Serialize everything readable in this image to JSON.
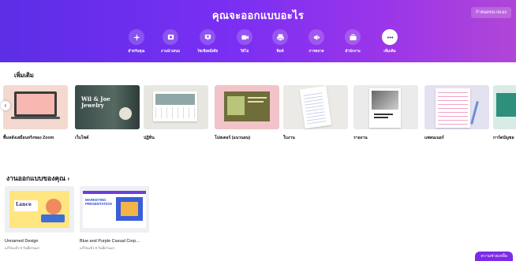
{
  "hero": {
    "title": "คุณจะออกแบบอะไร",
    "custom_size_button": "กำหนดขนาดเอง",
    "categories": [
      {
        "label": "สำหรับคุณ",
        "icon": "sparkle-icon"
      },
      {
        "label": "งานนำเสนอ",
        "icon": "presentation-icon"
      },
      {
        "label": "โซเชียลมีเดีย",
        "icon": "heart-chat-icon"
      },
      {
        "label": "วิดีโอ",
        "icon": "video-icon"
      },
      {
        "label": "พิมพ์",
        "icon": "print-icon"
      },
      {
        "label": "การตลาด",
        "icon": "megaphone-icon"
      },
      {
        "label": "สำนักงาน",
        "icon": "briefcase-icon"
      },
      {
        "label": "เพิ่มเติม",
        "icon": "more-icon"
      }
    ]
  },
  "more_section": {
    "title": "เพิ่มเติม",
    "tiles": [
      {
        "label": "พื้นหลังเสมือนจริงของ Zoom"
      },
      {
        "label": "เว็บไซต์"
      },
      {
        "label": "ปฏิทิน"
      },
      {
        "label": "โปสเตอร์ (แนวนอน)"
      },
      {
        "label": "ใบงาน"
      },
      {
        "label": "รายงาน"
      },
      {
        "label": "แพลนเนอร์"
      },
      {
        "label": "การ์ดบัญชอ"
      }
    ]
  },
  "your_designs": {
    "title": "งานออกแบบของคุณ ›",
    "items": [
      {
        "name": "Unnamed Design",
        "meta": "แก้ไขแล้ว 8 วันที่ผ่านมา",
        "thumb_text": "Lance"
      },
      {
        "name": "Blue and Purple Casual Corp...",
        "meta": "แก้ไขแล้ว 8 วันที่ผ่านมา",
        "thumb_text": "MARKETING PRESENTATION"
      }
    ]
  },
  "help_button": "ความช่วยเหลือ",
  "colors": {
    "hero_start": "#5c2ee6",
    "hero_end": "#b046d6",
    "accent": "#7d2ae8"
  }
}
